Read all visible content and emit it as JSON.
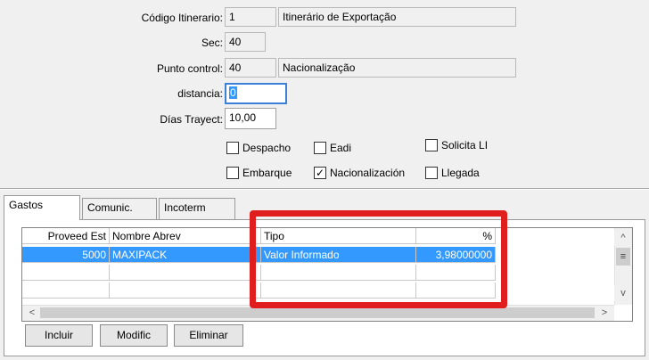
{
  "form": {
    "codigo_label": "Código Itinerario:",
    "codigo_value": "1",
    "codigo_desc": "Itinerário de Exportação",
    "sec_label": "Sec:",
    "sec_value": "40",
    "punto_label": "Punto control:",
    "punto_value": "40",
    "punto_desc": "Nacionalização",
    "distancia_label": "distancia:",
    "distancia_value": "0",
    "dias_label": "Días Trayect:",
    "dias_value": "10,00"
  },
  "checkboxes": [
    {
      "label": "Despacho",
      "checked": false
    },
    {
      "label": "Eadi",
      "checked": false
    },
    {
      "label": "Solicita LI",
      "checked": false
    },
    {
      "label": "Embarque",
      "checked": false
    },
    {
      "label": "Nacionalización",
      "checked": true
    },
    {
      "label": "Llegada",
      "checked": false
    }
  ],
  "tabs": [
    "Gastos",
    "Comunic.",
    "Incoterm"
  ],
  "grid": {
    "headers": [
      "Proveed Est",
      "Nombre Abrev",
      "Tipo",
      "%"
    ],
    "rows": [
      [
        "5000",
        "MAXIPACK",
        "Valor Informado",
        "3,98000000"
      ]
    ]
  },
  "buttons": {
    "incluir": "Incluir",
    "modific": "Modific",
    "eliminar": "Eliminar"
  },
  "scroll_icons": {
    "up": "^",
    "down": "v",
    "left": "<",
    "right": ">",
    "grip": "≡"
  },
  "highlight_color": "#e11e1e"
}
